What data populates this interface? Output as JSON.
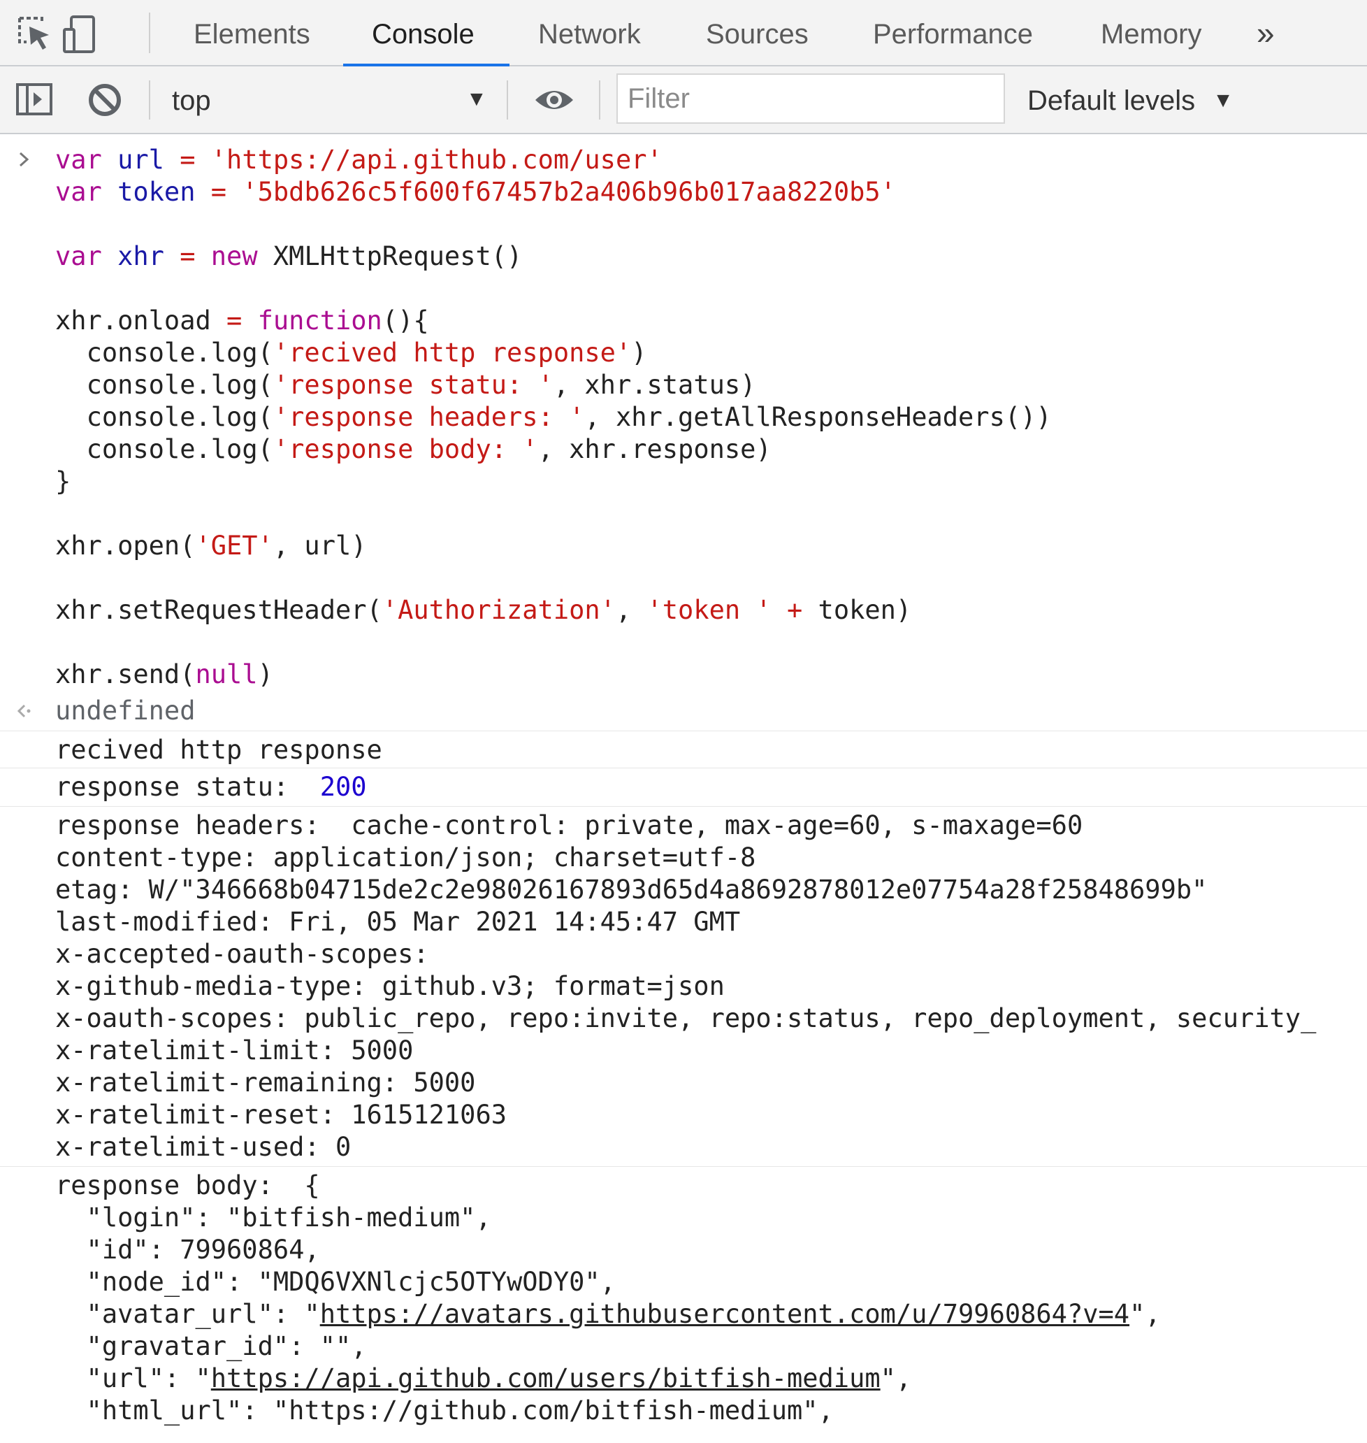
{
  "tabs": {
    "elements": "Elements",
    "console": "Console",
    "network": "Network",
    "sources": "Sources",
    "performance": "Performance",
    "memory": "Memory",
    "more": "»"
  },
  "toolbar": {
    "context": "top",
    "filter_placeholder": "Filter",
    "filter_value": "",
    "levels": "Default levels"
  },
  "input": {
    "url_var": "url",
    "url_value": "'https://api.github.com/user'",
    "token_var": "token",
    "token_value": "'5bdb626c5f600f67457b2a406b96b017aa8220b5'",
    "xhr_var": "xhr",
    "ctor": "XMLHttpRequest()",
    "onload_lhs": "xhr.onload",
    "fn_kw": "function",
    "fn_open": "(){",
    "log_fn": "console.log(",
    "log1_str": "'recived http response'",
    "log2_str": "'response statu: '",
    "log2_arg": ", xhr.status)",
    "log3_str": "'response headers: '",
    "log3_arg": ", xhr.getAllResponseHeaders())",
    "log4_str": "'response body: '",
    "log4_arg": ", xhr.response)",
    "fn_close": "}",
    "open_call": "xhr.open(",
    "open_method": "'GET'",
    "open_rest": ", url)",
    "setheader_call": "xhr.setRequestHeader(",
    "setheader_name": "'Authorization'",
    "setheader_prefix": "'token '",
    "setheader_rest": " token)",
    "send_call": "xhr.send(",
    "send_arg": "null",
    "send_close": ")"
  },
  "result": "undefined",
  "logs": {
    "recived": "recived http response",
    "status_label": "response statu: ",
    "status_value": "200",
    "headers_label": "response headers: ",
    "headers_lines": [
      "cache-control: private, max-age=60, s-maxage=60",
      "content-type: application/json; charset=utf-8",
      "etag: W/\"346668b04715de2c2e98026167893d65d4a8692878012e07754a28f25848699b\"",
      "last-modified: Fri, 05 Mar 2021 14:45:47 GMT",
      "x-accepted-oauth-scopes: ",
      "x-github-media-type: github.v3; format=json",
      "x-oauth-scopes: public_repo, repo:invite, repo:status, repo_deployment, security_",
      "x-ratelimit-limit: 5000",
      "x-ratelimit-remaining: 5000",
      "x-ratelimit-reset: 1615121063",
      "x-ratelimit-used: 0"
    ],
    "body_label": "response body: ",
    "body_open": "{",
    "body_login": "  \"login\": \"bitfish-medium\",",
    "body_id": "  \"id\": 79960864,",
    "body_node_id": "  \"node_id\": \"MDQ6VXNlcjc5OTYwODY0\",",
    "body_avatar_key": "  \"avatar_url\": \"",
    "body_avatar_url": "https://avatars.githubusercontent.com/u/79960864?v=4",
    "body_avatar_end": "\",",
    "body_gravatar": "  \"gravatar_id\": \"\",",
    "body_url_key": "  \"url\": \"",
    "body_url": "https://api.github.com/users/bitfish-medium",
    "body_url_end": "\",",
    "body_html_url_partial": "  \"html_url\": \"https://github.com/bitfish-medium\","
  },
  "colors": {
    "keyword": "#aa0d91",
    "variable": "#1a1aa6",
    "string": "#c41a16",
    "number": "#1c00cf",
    "active_tab_underline": "#1a73e8"
  },
  "icons": [
    "inspect-element-icon",
    "device-toolbar-icon",
    "chevron-double-right-icon",
    "sidebar-toggle-icon",
    "clear-console-icon",
    "dropdown-arrow-icon",
    "eye-icon",
    "prompt-chevron-icon",
    "result-arrow-icon"
  ]
}
